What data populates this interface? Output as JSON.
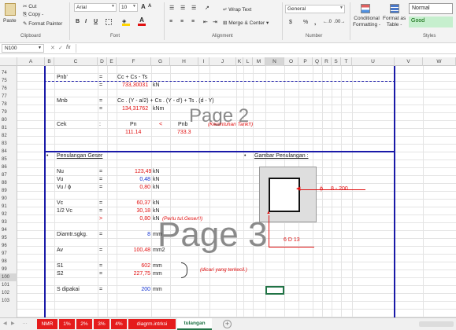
{
  "ribbon": {
    "clipboard": {
      "paste": "Paste",
      "cut": "Cut",
      "copy": "Copy -",
      "format_painter": "Format Painter",
      "label": "Clipboard"
    },
    "font": {
      "name": "Arial",
      "size": "10",
      "grow": "A",
      "shrink": "A",
      "bold": "B",
      "italic": "I",
      "underline": "U",
      "label": "Font"
    },
    "alignment": {
      "wrap_text": "Wrap Text",
      "merge_center": "Merge & Center",
      "label": "Alignment"
    },
    "number": {
      "format": "General",
      "dollar": "$",
      "percent": "%",
      "comma": ",",
      "label": "Number"
    },
    "styles": {
      "conditional": "Conditional",
      "formatting": "Formatting -",
      "format_as": "Format as",
      "table": "Table -",
      "normal": "Normal",
      "good": "Good",
      "label": "Styles"
    }
  },
  "formula_bar": {
    "name_box": "N100",
    "fx": "fx"
  },
  "columns": [
    "A",
    "B",
    "C",
    "D",
    "E",
    "F",
    "G",
    "H",
    "I",
    "J",
    "K",
    "L",
    "M",
    "N",
    "O",
    "P",
    "Q",
    "R",
    "S",
    "T",
    "U",
    "V",
    "W"
  ],
  "rows": [
    "74",
    "75",
    "76",
    "77",
    "78",
    "79",
    "80",
    "81",
    "82",
    "83",
    "84",
    "85",
    "86",
    "87",
    "88",
    "89",
    "90",
    "91",
    "92",
    "93",
    "94",
    "95",
    "96",
    "97",
    "98",
    "99",
    "100",
    "101",
    "102",
    "103"
  ],
  "cells": {
    "pnb_label": "Pnb'",
    "eq1": "=",
    "pnb_formula": "Cc + Cs - Ts",
    "eq2": "=",
    "pnb_value": "733,30031",
    "unit_kn1": "kN",
    "mnb_label": "Mnb",
    "eq3": "=",
    "mnb_formula": "Cc . (Y - a/2) + Cs . (Y - d') + Ts . (d - Y)",
    "eq4": "=",
    "mnb_value": "134,31762",
    "unit_knm": "kNm",
    "cek_label": "Cek",
    "colon": ":",
    "pn_label": "Pn",
    "lt": "<",
    "pnb_label2": "Pnb",
    "keruntuhan": "(Keruntuhan Tarik!!)",
    "pn_value": "111.14",
    "pnb_value2": "733.3",
    "bullet1": "•",
    "penulangan_geser": "Penulangan Geser",
    "bullet2": "•",
    "gambar_penulangan": "Gambar Penulangan :",
    "nu_label": "Nu",
    "eq5": "=",
    "nu_value": "123,49",
    "unit5": "kN",
    "vu_label": "Vu",
    "eq6": "=",
    "vu_value": "0,48",
    "unit6": "kN",
    "vuphi_label": "Vu / ϕ",
    "eq7": "=",
    "vuphi_value": "0,80",
    "unit7": "kN",
    "phi_sym": "ϕ",
    "stirrup_spec": "8 -    200",
    "vc_label": "Vc",
    "eq8": "=",
    "vc_value": "60,37",
    "unit8": "kN",
    "halfvc_label": "1/2 Vc",
    "eq9": "=",
    "halfvc_value": "30,18",
    "unit9": "kN",
    "gt": ">",
    "cmp_value": "0,80",
    "unit10": "kN",
    "perlu": "(Perlu tul.Geser!!)",
    "diamtr_label": "Diamtr.sgkg.",
    "eq11": "=",
    "diamtr_value": "8",
    "unit11": "mm",
    "bars_spec": "6 D    13",
    "av_label": "Av",
    "eq12": "=",
    "av_value": "100,48",
    "unit12": "mm2",
    "s1_label": "S1",
    "eq13": "=",
    "s1_value": "602",
    "unit13": "mm",
    "s2_label": "S2",
    "eq14": "=",
    "s2_value": "227,75",
    "unit14": "mm",
    "dicari": "(dicari yang terkecil.)",
    "sdipakai_label": "S dipakai",
    "eq15": "=",
    "sdipakai_value": "200",
    "unit15": "mm"
  },
  "watermarks": {
    "page2": "Page 2",
    "page3": "Page 3"
  },
  "sheet_tabs": [
    "NMR",
    "1%",
    "2%",
    "3%",
    "4%",
    "diagrm.intrksi",
    "tulangan"
  ],
  "active_tab": "tulangan",
  "colors": {
    "red": "#e01010",
    "blue": "#1030d0",
    "page_border": "#1a1aa8",
    "tab_red": "#e51c1c"
  }
}
